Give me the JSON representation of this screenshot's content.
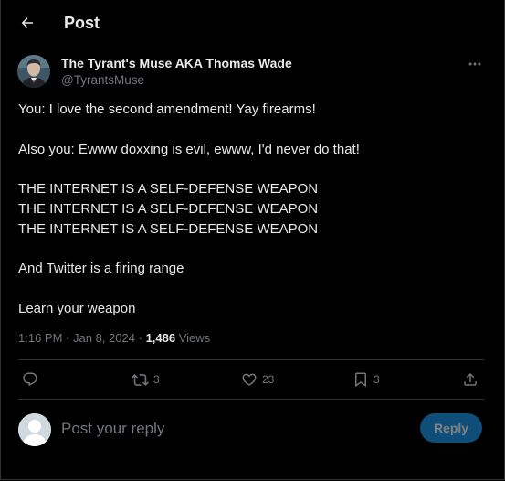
{
  "header": {
    "title": "Post",
    "back_icon": "arrow-left-icon"
  },
  "author": {
    "name": "The Tyrant's Muse AKA Thomas Wade",
    "handle": "@TyrantsMuse"
  },
  "post": {
    "lines": [
      "You: I love the second amendment!  Yay firearms!",
      "",
      "Also you: Ewww doxxing is evil, ewww, I'd never do that!",
      "",
      "THE INTERNET IS A SELF-DEFENSE WEAPON",
      "THE INTERNET IS A SELF-DEFENSE WEAPON",
      "THE INTERNET IS A SELF-DEFENSE WEAPON",
      "",
      "And Twitter is a firing range",
      "",
      "Learn your weapon"
    ]
  },
  "meta": {
    "time": "1:16 PM",
    "date": "Jan 8, 2024",
    "views_count": "1,486",
    "views_label": "Views",
    "separator": "·"
  },
  "actions": {
    "reply_count": "",
    "repost_count": "3",
    "like_count": "23",
    "bookmark_count": "3"
  },
  "composer": {
    "placeholder": "Post your reply",
    "button_label": "Reply"
  },
  "colors": {
    "background": "#000000",
    "text": "#e7e9ea",
    "secondary": "#71767b",
    "border": "#2f3336",
    "accent": "#1d9bf0"
  }
}
